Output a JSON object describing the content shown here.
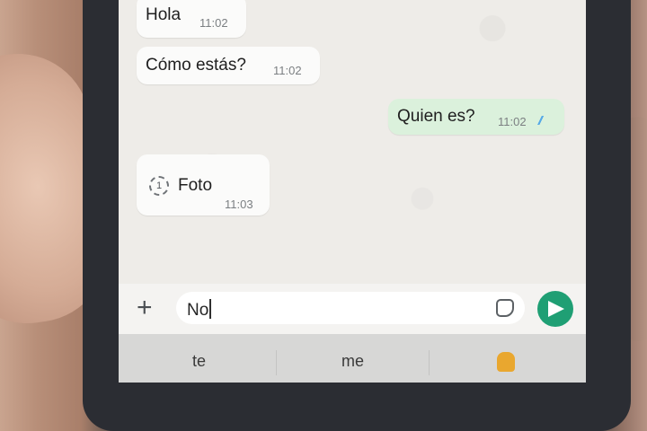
{
  "messages": [
    {
      "text": "Hola",
      "time": "11:02",
      "direction": "incoming"
    },
    {
      "text": "Cómo estás?",
      "time": "11:02",
      "direction": "incoming"
    },
    {
      "text": "Quien es?",
      "time": "11:02",
      "direction": "outgoing",
      "status": "read"
    },
    {
      "text": "Foto",
      "time": "11:03",
      "direction": "incoming",
      "type": "view-once-photo",
      "badge": "1"
    }
  ],
  "composer": {
    "value": "No",
    "icons": {
      "attach": "plus-icon",
      "sticker": "sticker-icon",
      "send": "send-icon"
    }
  },
  "keyboard": {
    "suggestions": [
      "te",
      "me"
    ],
    "emoji_suggestion": "thumbs-down-emoji"
  },
  "colors": {
    "send_button": "#1f9f74",
    "outgoing_bubble": "#dbf1dc",
    "read_ticks": "#4aa3e8"
  }
}
